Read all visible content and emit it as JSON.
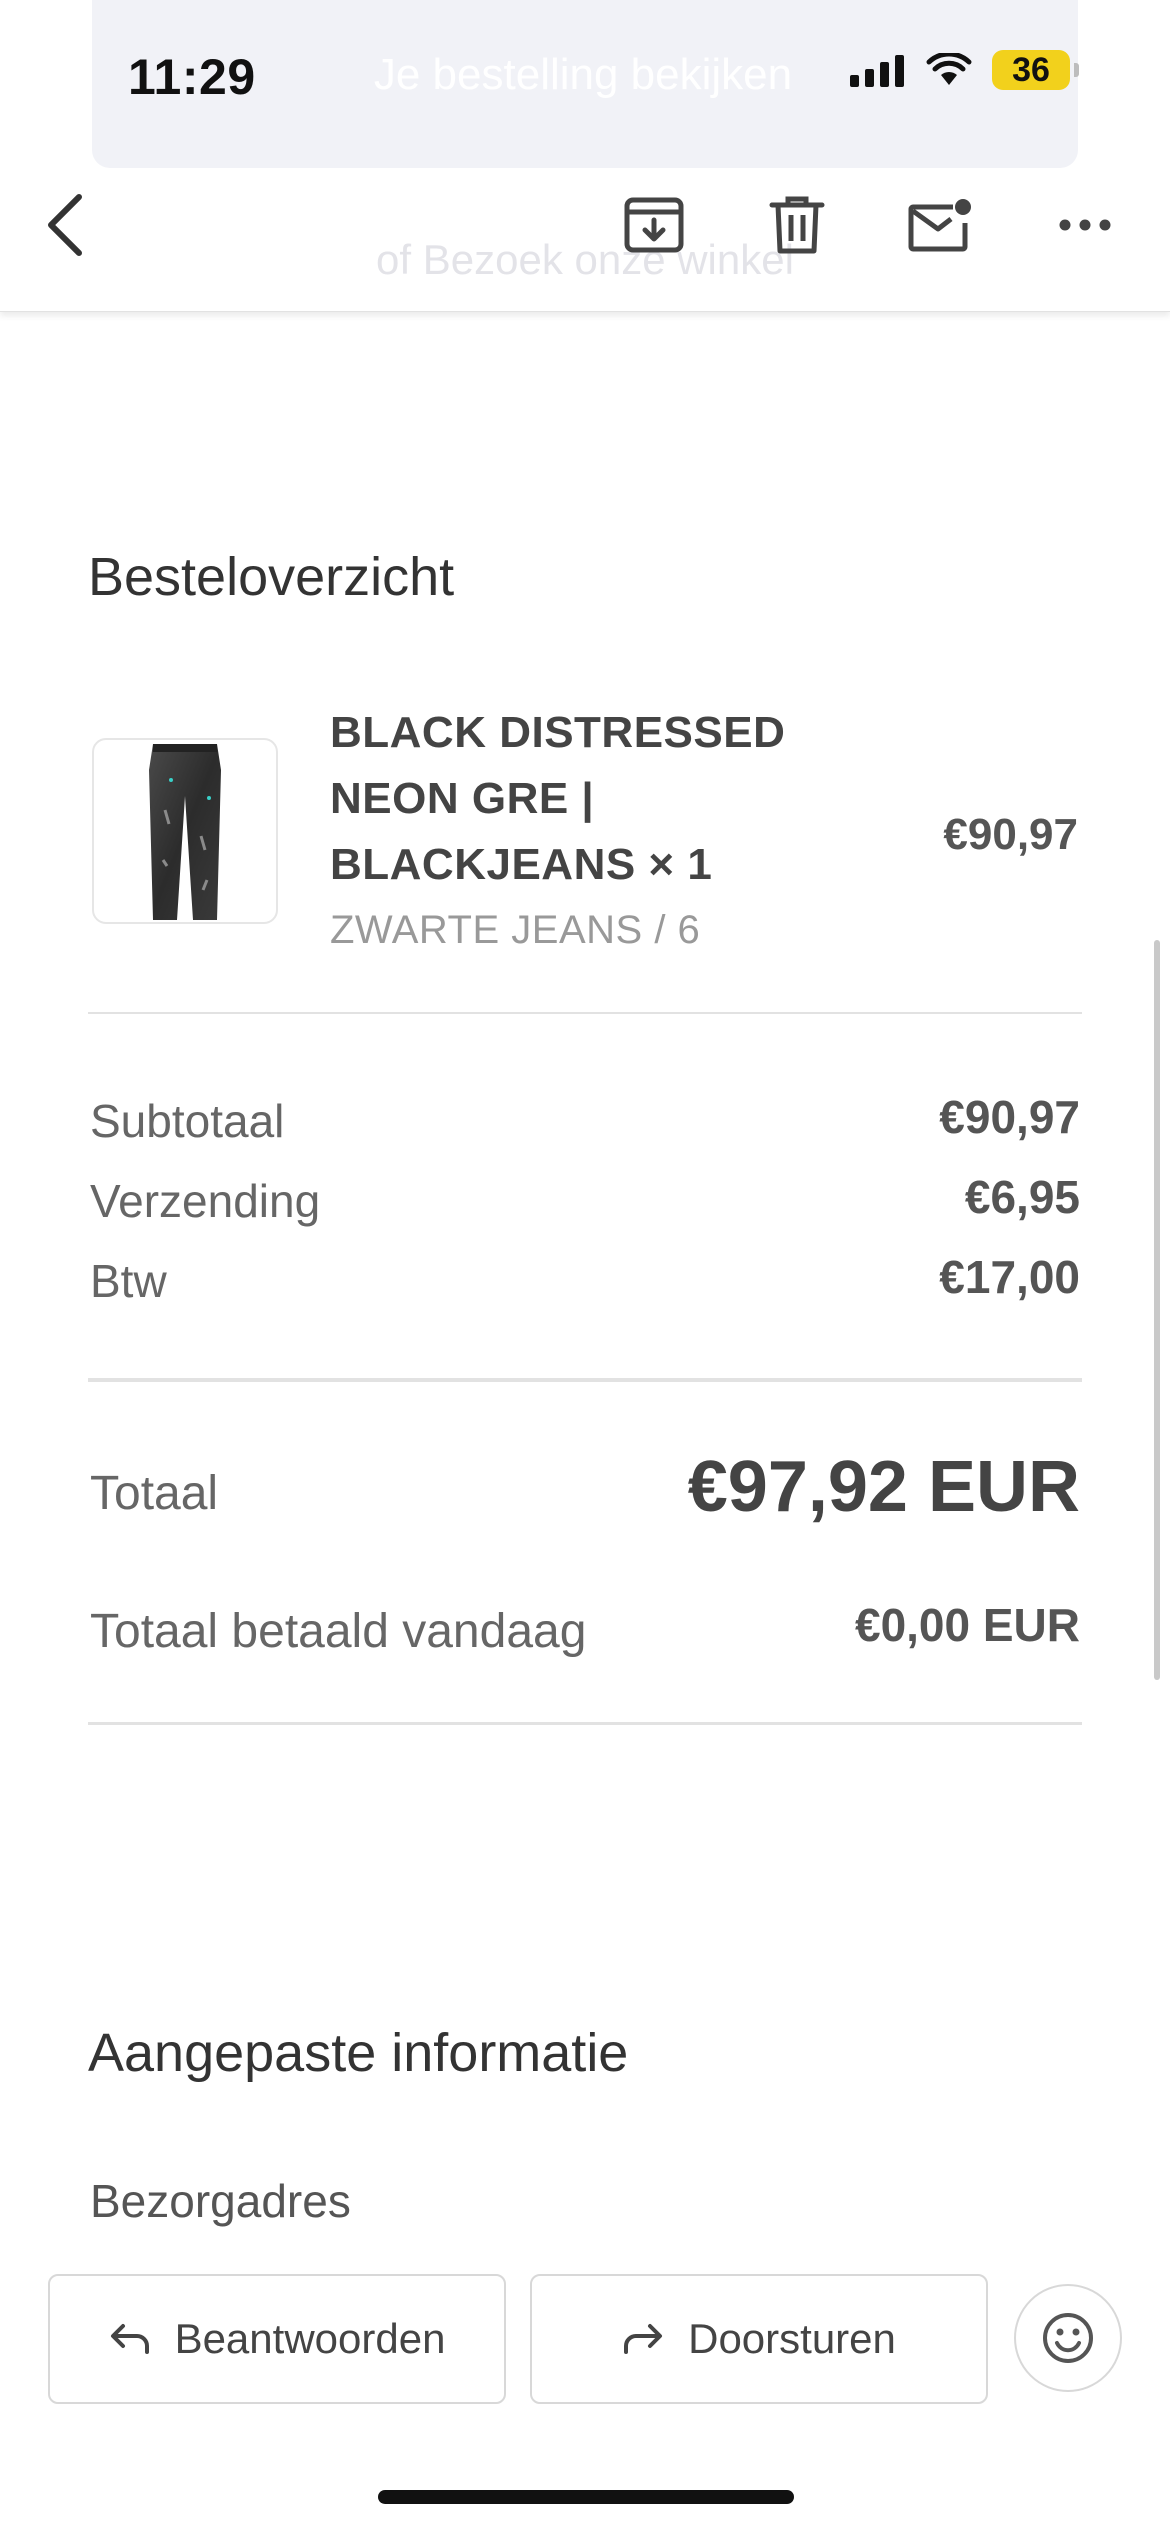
{
  "status_bar": {
    "time": "11:29",
    "battery": "36",
    "battery_color": "#f2d11c"
  },
  "background_email": {
    "banner_text": "Je bestelling bekijken",
    "link_text": "of Bezoek onze winkel"
  },
  "toolbar": {
    "icons": [
      "back-icon",
      "archive-icon",
      "trash-icon",
      "mail-unread-icon",
      "more-icon"
    ]
  },
  "order_summary": {
    "title": "Besteloverzicht",
    "item": {
      "name_line1": "BLACK DISTRESSED",
      "name_line2": "NEON GRE |",
      "name_line3": "BLACKJEANS × 1",
      "variant": "ZWARTE JEANS / 6",
      "price": "€90,97"
    },
    "rows": [
      {
        "label": "Subtotaal",
        "value": "€90,97"
      },
      {
        "label": "Verzending",
        "value": "€6,95"
      },
      {
        "label": "Btw",
        "value": "€17,00"
      }
    ],
    "total": {
      "label": "Totaal",
      "value": "€97,92 EUR"
    },
    "paid_today": {
      "label": "Totaal betaald vandaag",
      "value": "€0,00 EUR"
    }
  },
  "custom_info": {
    "title": "Aangepaste informatie",
    "address_label": "Bezorgadres"
  },
  "actions": {
    "reply_label": "Beantwoorden",
    "forward_label": "Doorsturen"
  }
}
